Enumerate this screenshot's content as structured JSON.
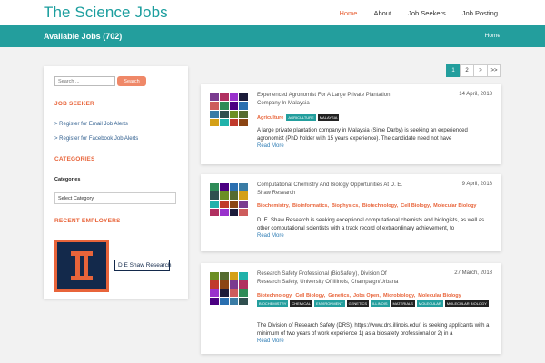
{
  "header": {
    "brand": "The Science Jobs",
    "nav": [
      "Home",
      "About",
      "Job Seekers",
      "Job Posting"
    ]
  },
  "titlebar": {
    "title": "Available Jobs (702)",
    "breadcrumb": "Home"
  },
  "sidebar": {
    "search_placeholder": "Search ...",
    "search_button": "Search",
    "job_seeker_heading": "JOB SEEKER",
    "links": [
      "> Register for Email Job Alerts",
      "> Register for Facebook Job Alerts"
    ],
    "categories_heading": "CATEGORIES",
    "categories_label": "Categories",
    "category_selected": "Select Category",
    "recent_heading": "RECENT EMPLOYERS",
    "employer_name": "D E Shaw Research"
  },
  "pagination": [
    "1",
    "2",
    ">",
    ">>"
  ],
  "jobs": [
    {
      "title": "Experienced Agronomist For A Large Private Plantation Company In Malaysia",
      "date": "14 April, 2018",
      "tag_links": [
        "Agriculture"
      ],
      "chips": [
        "AGRICULTURE",
        "MALAYSIA"
      ],
      "description": "A large private plantation company in Malaysia (Sime Darby) is seeking an experienced agronomist (PhD holder with 15 years experience). The candidate need not have",
      "more": "Read More"
    },
    {
      "title": "Computational Chemistry And Biology Opportunities At D. E. Shaw Research",
      "date": "9 April, 2018",
      "tag_links": [
        "Biochemistry,",
        "Bioinformatics,",
        "Biophysics,",
        "Biotechnology,",
        "Cell Biology,",
        "Molecular Biology"
      ],
      "chips": [],
      "description": "D. E. Shaw Research is seeking exceptional computational chemists and biologists, as well as other computational scientists with a track record of extraordinary achievement, to",
      "more": "Read More"
    },
    {
      "title": "Research Safety Professional (BioSafety), Division Of Research Safety, University Of Illinois, Champaign/Urbana",
      "date": "27 March, 2018",
      "tag_links": [
        "Biotechnology,",
        "Cell Biology,",
        "Genetics,",
        "Jobs Open,",
        "Microbiology,",
        "Molecular Biology"
      ],
      "chips": [
        "BIOCHEMISTRY",
        "CHEMICAL",
        "ENVIRONMENT",
        "GENETICS",
        "ILLINOIS",
        "MATERIALS",
        "MOLECULAR",
        "MOLECULAR BIOLOGY"
      ],
      "description": "The Division of Research Safety (DRS), https://www.drs.illinois.edu/, is seeking applicants with a minimum of two years of work experience 1) as a biosafety professional or 2) in a",
      "more": "Read More"
    }
  ],
  "colors": {
    "brand": "#1c9e9e",
    "titlebar": "#239e9d",
    "accent": "#e8643a"
  }
}
